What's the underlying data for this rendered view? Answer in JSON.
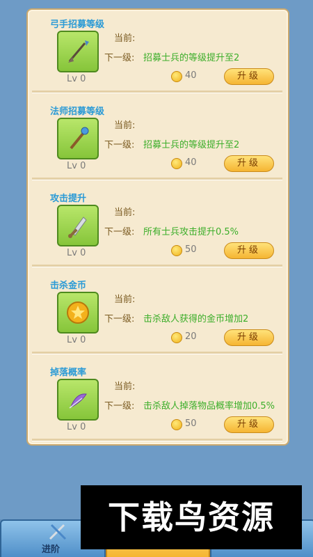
{
  "upgrade_items": [
    {
      "title": "弓手招募等级",
      "icon": "bow-arrow-icon",
      "level": "Lv 0",
      "current_label": "当前:",
      "next_label": "下一级:",
      "next_text": "招募士兵的等级提升至2",
      "cost": "40",
      "button_label": "升级"
    },
    {
      "title": "法师招募等级",
      "icon": "staff-icon",
      "level": "Lv 0",
      "current_label": "当前:",
      "next_label": "下一级:",
      "next_text": "招募士兵的等级提升至2",
      "cost": "40",
      "button_label": "升级"
    },
    {
      "title": "攻击提升",
      "icon": "sword-icon",
      "level": "Lv 0",
      "current_label": "当前:",
      "next_label": "下一级:",
      "next_text": "所有士兵攻击提升0.5%",
      "cost": "50",
      "button_label": "升级"
    },
    {
      "title": "击杀金币",
      "icon": "gold-coin-icon",
      "level": "Lv 0",
      "current_label": "当前:",
      "next_label": "下一级:",
      "next_text": "击杀敌人获得的金币增加2",
      "cost": "20",
      "button_label": "升级"
    },
    {
      "title": "掉落概率",
      "icon": "feather-icon",
      "level": "Lv 0",
      "current_label": "当前:",
      "next_label": "下一级:",
      "next_text": "击杀敌人掉落物品概率增加0.5%",
      "cost": "50",
      "button_label": "升级"
    }
  ],
  "bottom_nav": {
    "advance_label": "进阶"
  },
  "watermark": {
    "text": "下载鸟资源"
  },
  "colors": {
    "title": "#2a9ad6",
    "next_text": "#3cae2a",
    "button": "#f5b532"
  }
}
